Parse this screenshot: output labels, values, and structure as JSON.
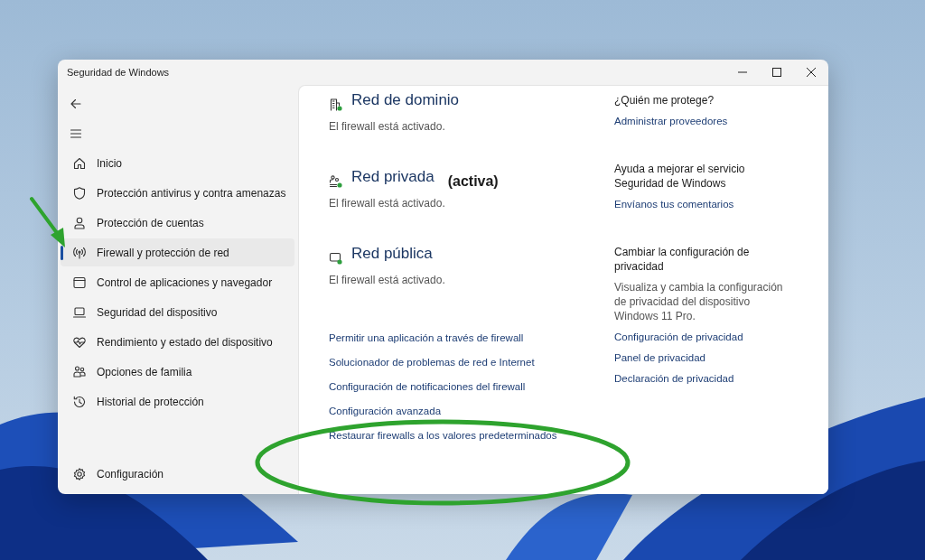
{
  "window": {
    "title": "Seguridad de Windows"
  },
  "sidebar": {
    "items": [
      {
        "label": "Inicio",
        "selected": false
      },
      {
        "label": "Protección antivirus y contra amenazas",
        "selected": false
      },
      {
        "label": "Protección de cuentas",
        "selected": false
      },
      {
        "label": "Firewall y protección de red",
        "selected": true
      },
      {
        "label": "Control de aplicaciones y navegador",
        "selected": false
      },
      {
        "label": "Seguridad del dispositivo",
        "selected": false
      },
      {
        "label": "Rendimiento y estado del dispositivo",
        "selected": false
      },
      {
        "label": "Opciones de familia",
        "selected": false
      },
      {
        "label": "Historial de protección",
        "selected": false
      }
    ],
    "footer": "Configuración"
  },
  "networks": [
    {
      "name": "Red de dominio",
      "status": "El firewall está activado."
    },
    {
      "name": "Red privada",
      "tag": "(activa)",
      "status": "El firewall está activado."
    },
    {
      "name": "Red pública",
      "status": "El firewall está activado."
    }
  ],
  "links": [
    "Permitir una aplicación a través de firewall",
    "Solucionador de problemas de red e Internet",
    "Configuración de notificaciones del firewall",
    "Configuración avanzada",
    "Restaurar firewalls a los valores predeterminados"
  ],
  "right_panel": [
    {
      "heading": "¿Quién me protege?",
      "links": [
        "Administrar proveedores"
      ]
    },
    {
      "heading": "Ayuda a mejorar el servicio Seguridad de Windows",
      "links": [
        "Envíanos tus comentarios"
      ]
    },
    {
      "heading": "Cambiar la configuración de privacidad",
      "description": "Visualiza y cambia la configuración de privacidad del dispositivo Windows 11 Pro.",
      "links": [
        "Configuración de privacidad",
        "Panel de privacidad",
        "Declaración de privacidad"
      ]
    }
  ]
}
